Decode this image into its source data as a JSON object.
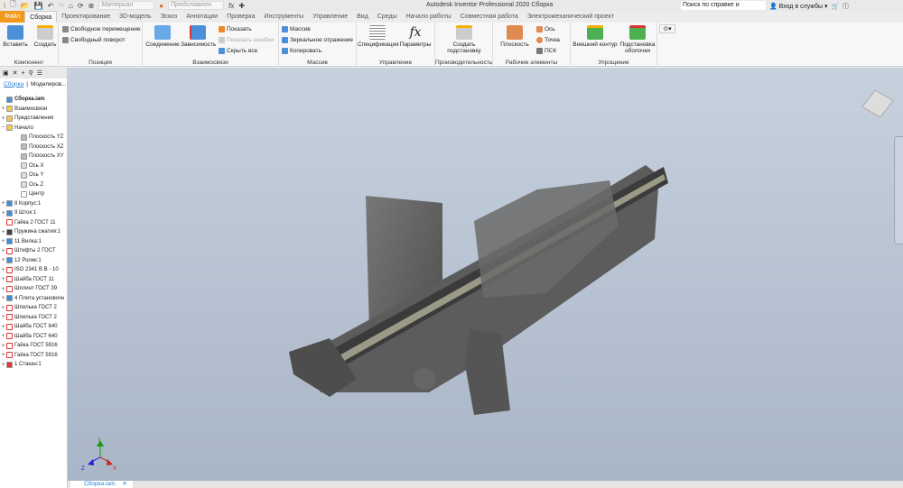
{
  "titlebar": {
    "title": "Autodesk Inventor Professional 2020   Сборка",
    "material": "Материал",
    "appearance": "Представлен",
    "search_placeholder": "Поиск по справке и командам.",
    "login": "Вход в службы"
  },
  "tabs": [
    "Файл",
    "Сборка",
    "Проектирование",
    "3D-модель",
    "Эскиз",
    "Аннотации",
    "Проверка",
    "Инструменты",
    "Управление",
    "Вид",
    "Среды",
    "Начало работы",
    "Совместная работа",
    "Электромеханический проект"
  ],
  "ribbon": {
    "component": {
      "label": "Компонент",
      "insert": "Вставить",
      "create": "Создать"
    },
    "position": {
      "label": "Позиция",
      "free_move": "Свободное перемещение",
      "free_rotate": "Свободный поворот"
    },
    "relationships": {
      "label": "Взаимосвязи",
      "joint": "Соединение",
      "constrain": "Зависимость",
      "show": "Показать",
      "show_errors": "Показать ошибки",
      "hide_all": "Скрыть все"
    },
    "pattern": {
      "label": "Массив",
      "pattern": "Массив",
      "mirror": "Зеркальное отражение",
      "copy": "Копировать"
    },
    "manage": {
      "label": "Управление",
      "bom": "Спецификация",
      "params": "Параметры"
    },
    "productivity": {
      "label": "Производительность",
      "substitute": "Создать подстановку"
    },
    "work_features": {
      "label": "Рабочие элементы",
      "plane": "Плоскость",
      "axis": "Ось",
      "point": "Точка",
      "ucs": "ПСК"
    },
    "simplification": {
      "label": "Упрощение",
      "shrinkwrap": "Внешний контур",
      "shell_sub": "Подстановка оболочки"
    }
  },
  "browser": {
    "tab1": "Сборка",
    "tab2": "Моделиров...",
    "items": [
      {
        "label": "Сборка.iam",
        "level": 0,
        "icon": "assembly",
        "bold": true
      },
      {
        "label": "Взаимосвязи",
        "level": 0,
        "icon": "folder",
        "pm": "+"
      },
      {
        "label": "Представления",
        "level": 0,
        "icon": "folder",
        "pm": "+"
      },
      {
        "label": "Начало",
        "level": 0,
        "icon": "folder",
        "pm": "−"
      },
      {
        "label": "Плоскость YZ",
        "level": 1,
        "icon": "plane"
      },
      {
        "label": "Плоскость XZ",
        "level": 1,
        "icon": "plane"
      },
      {
        "label": "Плоскость XY",
        "level": 1,
        "icon": "plane"
      },
      {
        "label": "Ось X",
        "level": 1,
        "icon": "axis"
      },
      {
        "label": "Ось Y",
        "level": 1,
        "icon": "axis"
      },
      {
        "label": "Ось Z",
        "level": 1,
        "icon": "axis"
      },
      {
        "label": "Центр",
        "level": 1,
        "icon": "point"
      },
      {
        "label": "8 Корпус:1",
        "level": 0,
        "icon": "part",
        "pm": "+"
      },
      {
        "label": "9 Шток:1",
        "level": 0,
        "icon": "part",
        "pm": "+"
      },
      {
        "label": "Гайка 2 ГОСТ 11",
        "level": 0,
        "icon": "cc"
      },
      {
        "label": "Пружина сжатия:1",
        "level": 0,
        "icon": "spring",
        "pm": "+"
      },
      {
        "label": "11 Вилка:1",
        "level": 0,
        "icon": "part",
        "pm": "+"
      },
      {
        "label": "Штифты 2 ГОСТ",
        "level": 0,
        "icon": "cc",
        "pm": "+"
      },
      {
        "label": "12 Ролик:1",
        "level": 0,
        "icon": "part",
        "pm": "+"
      },
      {
        "label": "ISO 2341 B B - 10",
        "level": 0,
        "icon": "cc",
        "pm": "+"
      },
      {
        "label": "Шайба  ГОСТ 11",
        "level": 0,
        "icon": "cc",
        "pm": "+"
      },
      {
        "label": "Шплинт ГОСТ 39",
        "level": 0,
        "icon": "cc",
        "pm": "+"
      },
      {
        "label": "4 Плита установочн",
        "level": 0,
        "icon": "part",
        "pm": "+"
      },
      {
        "label": "Шпилька ГОСТ 2",
        "level": 0,
        "icon": "cc",
        "pm": "+"
      },
      {
        "label": "Шпилька ГОСТ 2",
        "level": 0,
        "icon": "cc",
        "pm": "+"
      },
      {
        "label": "Шайба ГОСТ 640",
        "level": 0,
        "icon": "cc",
        "pm": "+"
      },
      {
        "label": "Шайба ГОСТ 640",
        "level": 0,
        "icon": "cc",
        "pm": "+"
      },
      {
        "label": "Гайка ГОСТ 5916",
        "level": 0,
        "icon": "cc",
        "pm": "+"
      },
      {
        "label": "Гайка ГОСТ 5916",
        "level": 0,
        "icon": "cc",
        "pm": "+"
      },
      {
        "label": "1 Стакан:1",
        "level": 0,
        "icon": "adaptive",
        "pm": "+"
      }
    ]
  },
  "doc_tab": "Сборка.iam",
  "triad": {
    "x": "X",
    "y": "Y",
    "z": "Z"
  },
  "colors": {
    "file_tab": "#f39a1e",
    "link": "#2a7fd0",
    "viewport_top": "#c7d1de",
    "viewport_bottom": "#a9b6c7"
  }
}
